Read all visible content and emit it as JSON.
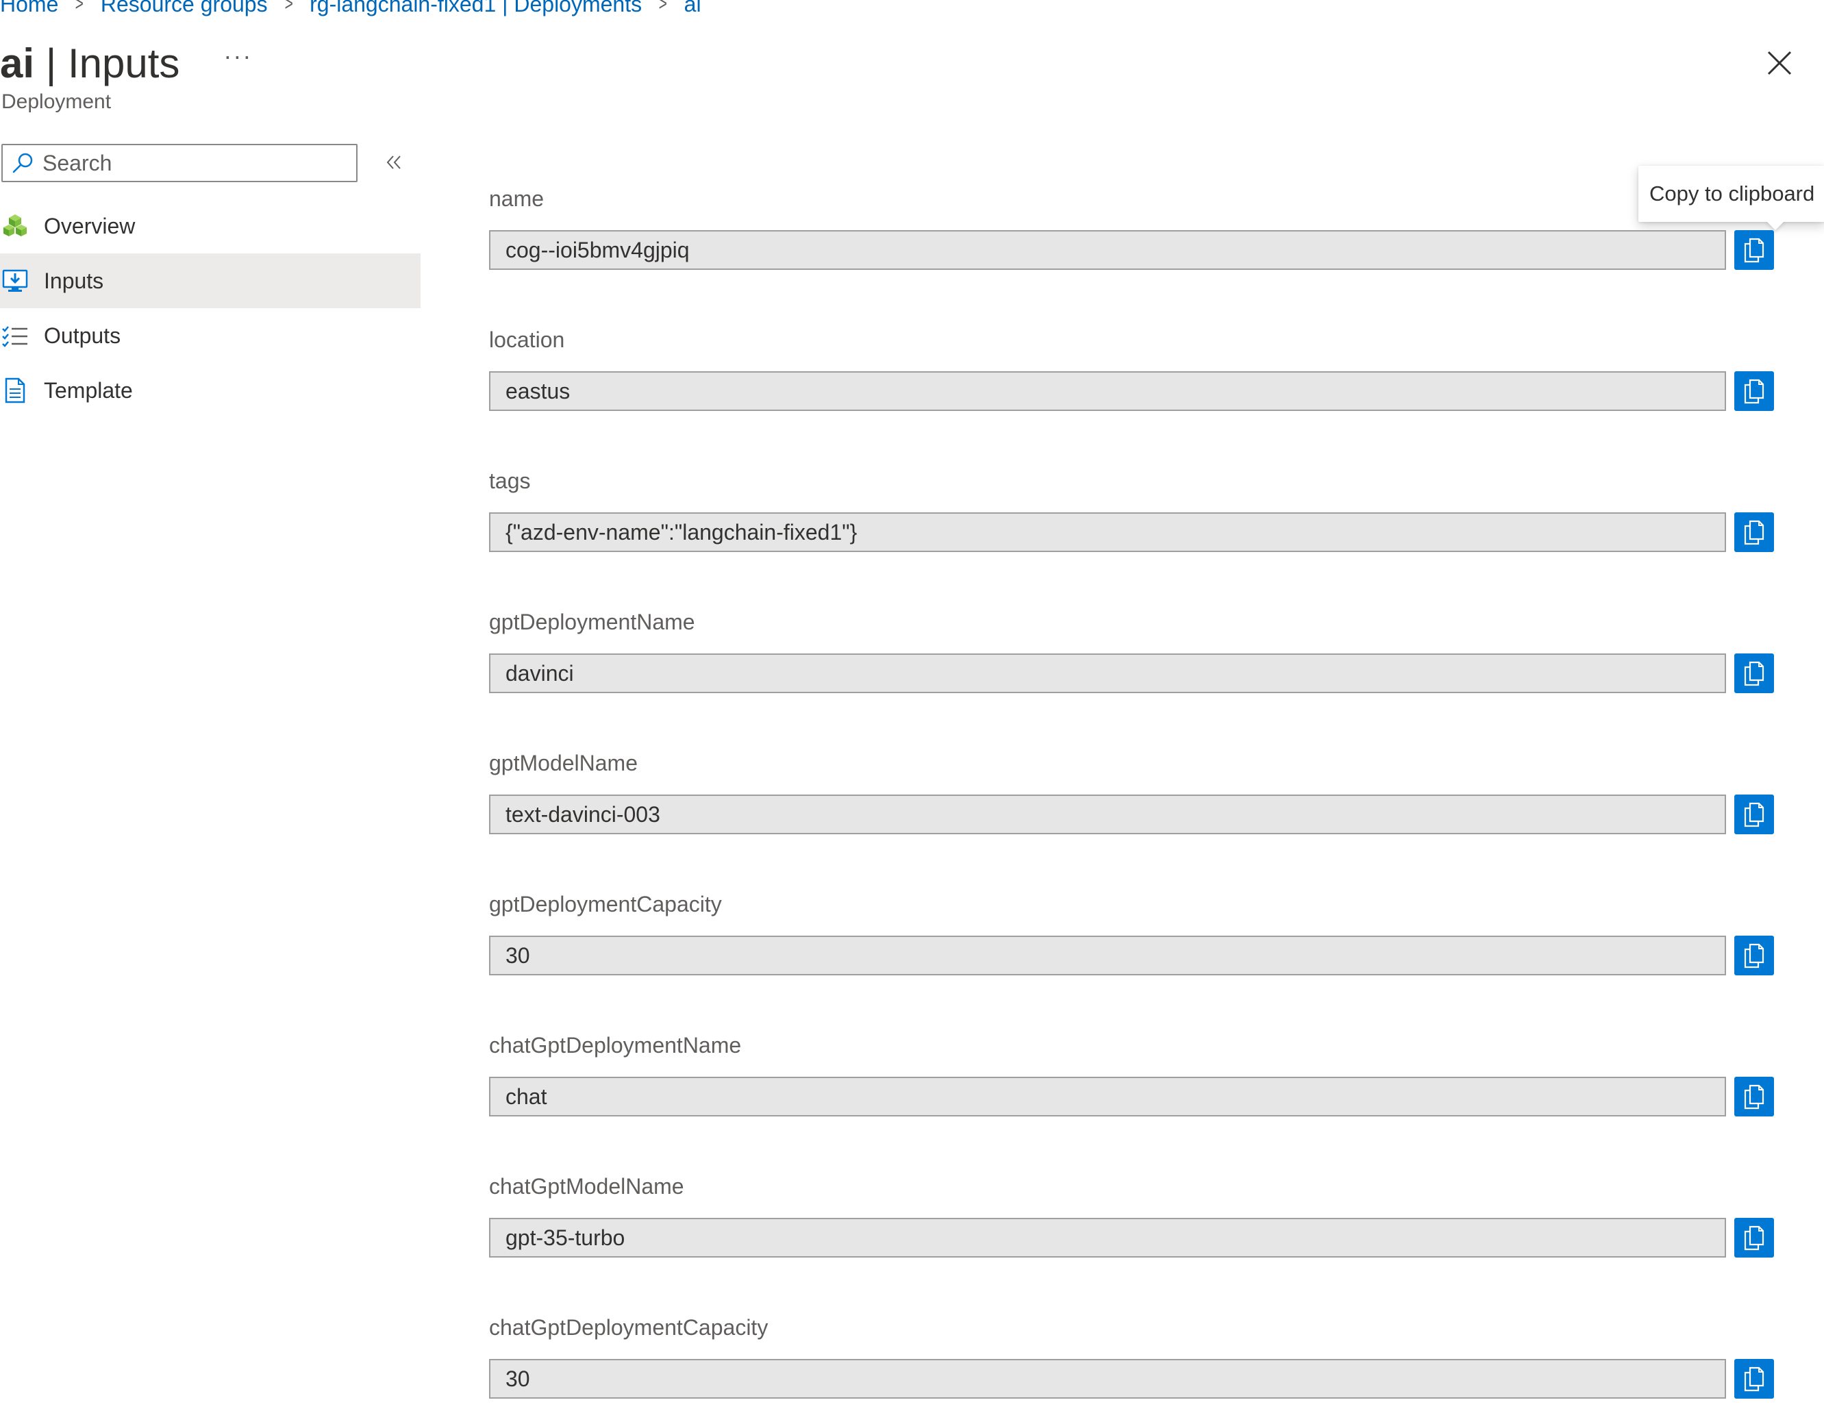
{
  "breadcrumb": {
    "items": [
      "Home",
      "Resource groups",
      "rg-langchain-fixed1 | Deployments",
      "ai"
    ],
    "separator": ">"
  },
  "header": {
    "title_strong": "ai",
    "title_rest": " | Inputs",
    "more_label": "···",
    "subtitle": "Deployment"
  },
  "search": {
    "placeholder": "Search"
  },
  "sidebar": {
    "items": [
      {
        "label": "Overview",
        "icon": "overview-cubes-icon",
        "active": false
      },
      {
        "label": "Inputs",
        "icon": "inputs-monitor-download-icon",
        "active": true
      },
      {
        "label": "Outputs",
        "icon": "outputs-checklist-icon",
        "active": false
      },
      {
        "label": "Template",
        "icon": "template-document-icon",
        "active": false
      }
    ]
  },
  "tooltip": {
    "text": "Copy to clipboard"
  },
  "fields": [
    {
      "label": "name",
      "value": "cog--ioi5bmv4gjpiq"
    },
    {
      "label": "location",
      "value": "eastus"
    },
    {
      "label": "tags",
      "value": "{\"azd-env-name\":\"langchain-fixed1\"}"
    },
    {
      "label": "gptDeploymentName",
      "value": "davinci"
    },
    {
      "label": "gptModelName",
      "value": "text-davinci-003"
    },
    {
      "label": "gptDeploymentCapacity",
      "value": "30"
    },
    {
      "label": "chatGptDeploymentName",
      "value": "chat"
    },
    {
      "label": "chatGptModelName",
      "value": "gpt-35-turbo"
    },
    {
      "label": "chatGptDeploymentCapacity",
      "value": "30"
    }
  ],
  "colors": {
    "accent": "#0078d4",
    "link": "#0067b8",
    "field_bg": "#e6e6e6",
    "active_nav_bg": "#edebe9"
  }
}
